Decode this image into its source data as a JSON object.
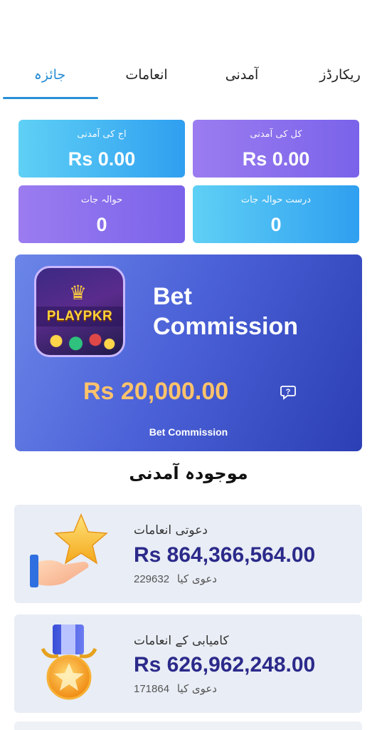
{
  "tabs": [
    {
      "label": "ریکارڈز"
    },
    {
      "label": "آمدنی"
    },
    {
      "label": "انعامات"
    },
    {
      "label": "جائزہ",
      "active": true
    }
  ],
  "stats": {
    "total_income_label": "کل کی آمدنی",
    "total_income_value": "Rs 0.00",
    "today_income_label": "اج کی آمدنی",
    "today_income_value": "Rs 0.00",
    "valid_referrals_label": "درست حوالہ جات",
    "valid_referrals_value": "0",
    "referrals_label": "حوالہ جات",
    "referrals_value": "0"
  },
  "banner": {
    "logo_text": "PLAYPKR",
    "title": "Bet Commission",
    "amount": "Rs 20,000.00",
    "subtitle": "Bet Commission",
    "help_icon": "question-bubble-icon"
  },
  "section_title": "موجودہ آمدنی",
  "income_cards": [
    {
      "title": "دعوتی انعامات",
      "amount": "Rs 864,366,564.00",
      "count": "229632",
      "count_label": "دعوی کیا",
      "icon": "star-hand-icon"
    },
    {
      "title": "کامیابی کے انعامات",
      "amount": "Rs 626,962,248.00",
      "count": "171864",
      "count_label": "دعوی کیا",
      "icon": "medal-icon"
    }
  ],
  "colors": {
    "accent": "#2a8fd6",
    "amount_text": "#2b2a8a",
    "banner_amount": "#ffc36b"
  }
}
